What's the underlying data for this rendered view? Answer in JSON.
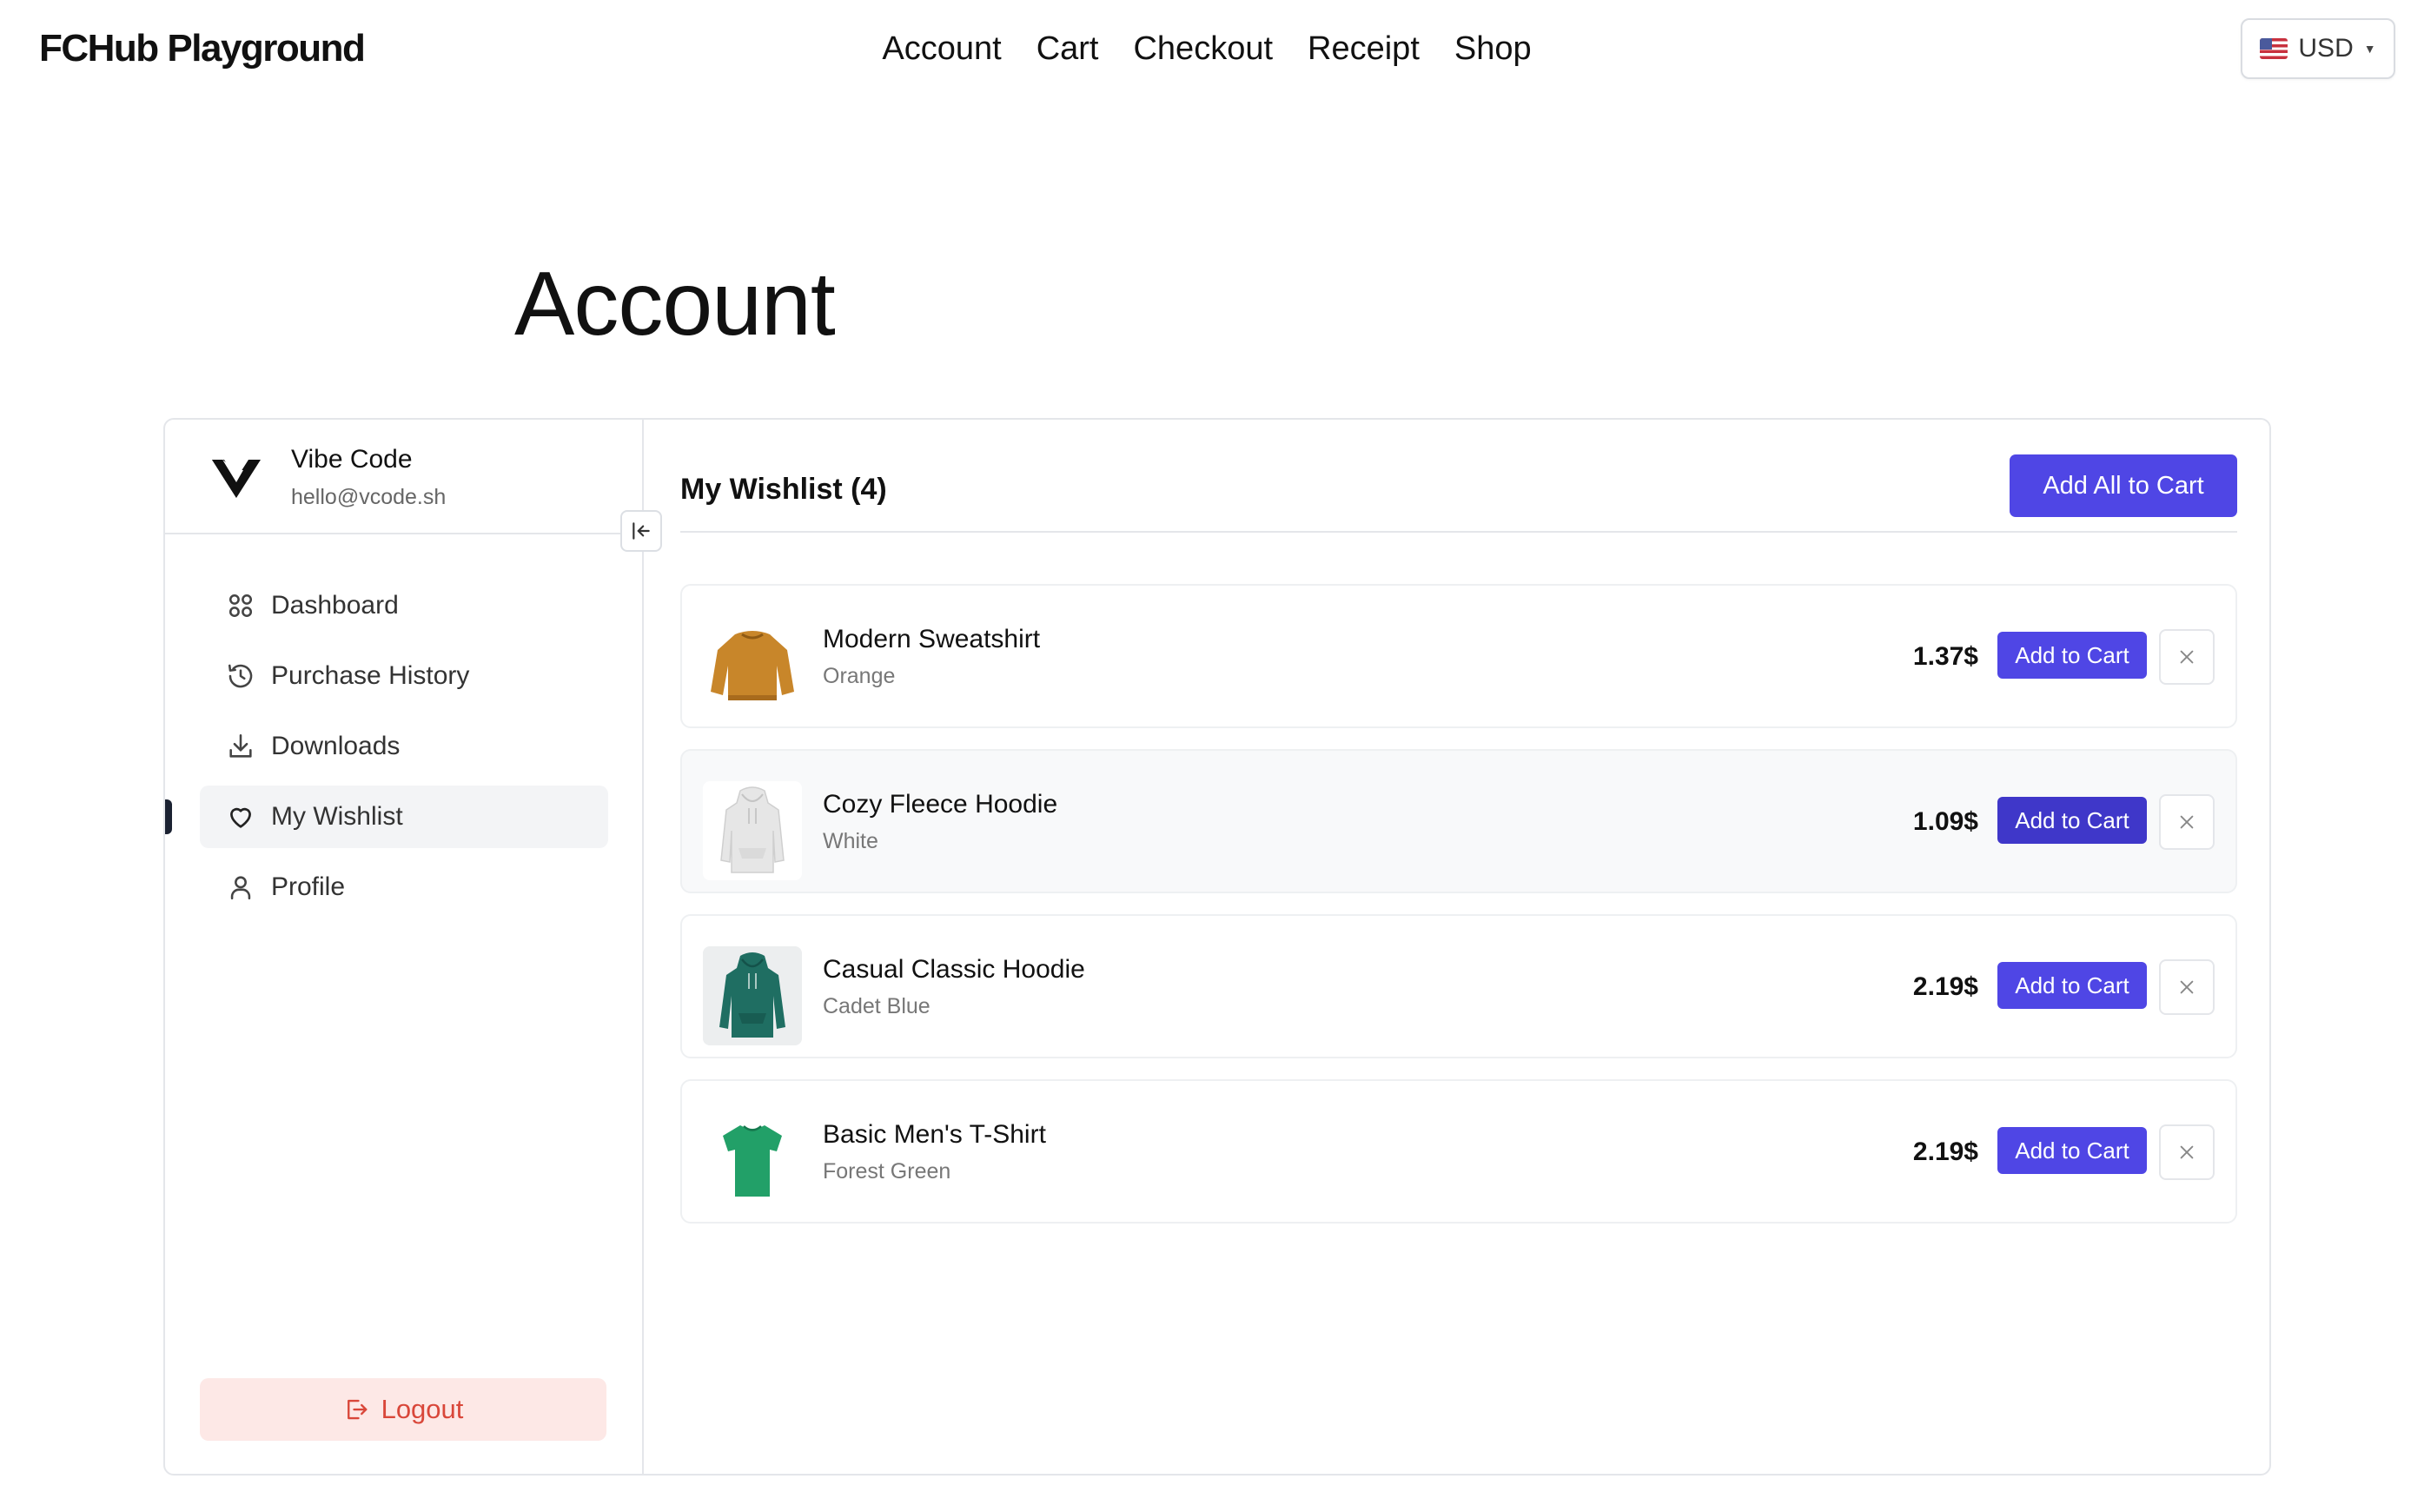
{
  "header": {
    "logo": "FCHub Playground",
    "nav": [
      "Account",
      "Cart",
      "Checkout",
      "Receipt",
      "Shop"
    ],
    "currency": "USD"
  },
  "page": {
    "title": "Account"
  },
  "user": {
    "name": "Vibe Code",
    "email": "hello@vcode.sh"
  },
  "sidebar": {
    "items": [
      {
        "label": "Dashboard",
        "icon": "grid-icon"
      },
      {
        "label": "Purchase History",
        "icon": "history-icon"
      },
      {
        "label": "Downloads",
        "icon": "download-icon"
      },
      {
        "label": "My Wishlist",
        "icon": "heart-icon",
        "active": true
      },
      {
        "label": "Profile",
        "icon": "user-icon"
      }
    ],
    "logout_label": "Logout"
  },
  "wishlist": {
    "title": "My Wishlist (4)",
    "add_all_label": "Add All to Cart",
    "add_to_cart_label": "Add to Cart",
    "items": [
      {
        "name": "Modern Sweatshirt",
        "color": "Orange",
        "price": "1.37$",
        "swatch": "#c8862a"
      },
      {
        "name": "Cozy Fleece Hoodie",
        "color": "White",
        "price": "1.09$",
        "swatch": "#e8e8e8"
      },
      {
        "name": "Casual Classic Hoodie",
        "color": "Cadet Blue",
        "price": "2.19$",
        "swatch": "#1f6e62"
      },
      {
        "name": "Basic Men's T-Shirt",
        "color": "Forest Green",
        "price": "2.19$",
        "swatch": "#22a068"
      }
    ]
  },
  "colors": {
    "accent": "#4f46e5",
    "logout_bg": "#fde8e6",
    "logout_text": "#d9473a"
  }
}
